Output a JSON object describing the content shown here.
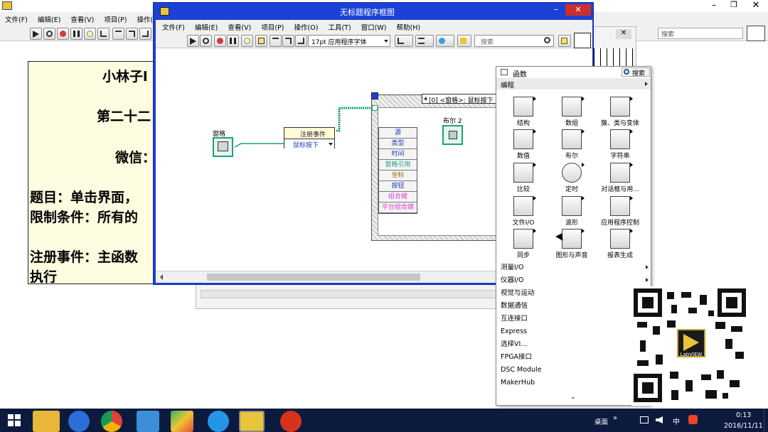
{
  "back_window": {
    "menu": [
      "文件(F)",
      "编辑(E)",
      "查看(V)",
      "项目(P)",
      "操作(O)"
    ],
    "search_placeholder": "搜索",
    "slide_lines": [
      "小林子l",
      "第二十二",
      "微信：",
      "题目：单击界面，",
      "限制条件：所有的",
      "注册事件：主函数",
      "执行"
    ]
  },
  "block_diagram": {
    "title": "无标题程序框图",
    "menu": [
      "文件(F)",
      "编辑(E)",
      "查看(V)",
      "项目(P)",
      "操作(O)",
      "工具(T)",
      "窗口(W)",
      "帮助(H)"
    ],
    "font_select": "17pt 应用程序字体",
    "search_placeholder": "搜索",
    "pane_control": "窗格",
    "register_events": "注册事件",
    "register_item": "鼠标按下",
    "event_case": "[0] <窗格>: 鼠标按下",
    "bool_control": "布尔 2",
    "event_data": [
      "源",
      "类型",
      "时间",
      "窗格引用",
      "坐标",
      "按钮",
      "组合键",
      "平台组合键"
    ]
  },
  "palette": {
    "title": "函数",
    "search_label": "搜索",
    "category": "编程",
    "items": [
      "结构",
      "数组",
      "簇、类与变体",
      "数值",
      "布尔",
      "字符串",
      "比较",
      "定时",
      "对话框与用...",
      "文件I/O",
      "波形",
      "应用程序控制",
      "同步",
      "图形与声音",
      "报表生成"
    ],
    "sub_categories": [
      "测量I/O",
      "仪器I/O",
      "视觉与运动",
      "数据通信",
      "互连接口",
      "Express",
      "选择VI...",
      "FPGA接口",
      "DSC Module",
      "MakerHub"
    ]
  },
  "qr": {
    "label": "LabVIEW"
  },
  "taskbar": {
    "desktop_label": "桌面",
    "ime": "中",
    "time": "0:13",
    "date": "2016/11/11"
  },
  "colors": {
    "titlebar_blue": "#1d41d6",
    "taskbar": "#0c1a3e",
    "slide_bg": "#fdfce0",
    "event_wire": "#1fa07a"
  }
}
